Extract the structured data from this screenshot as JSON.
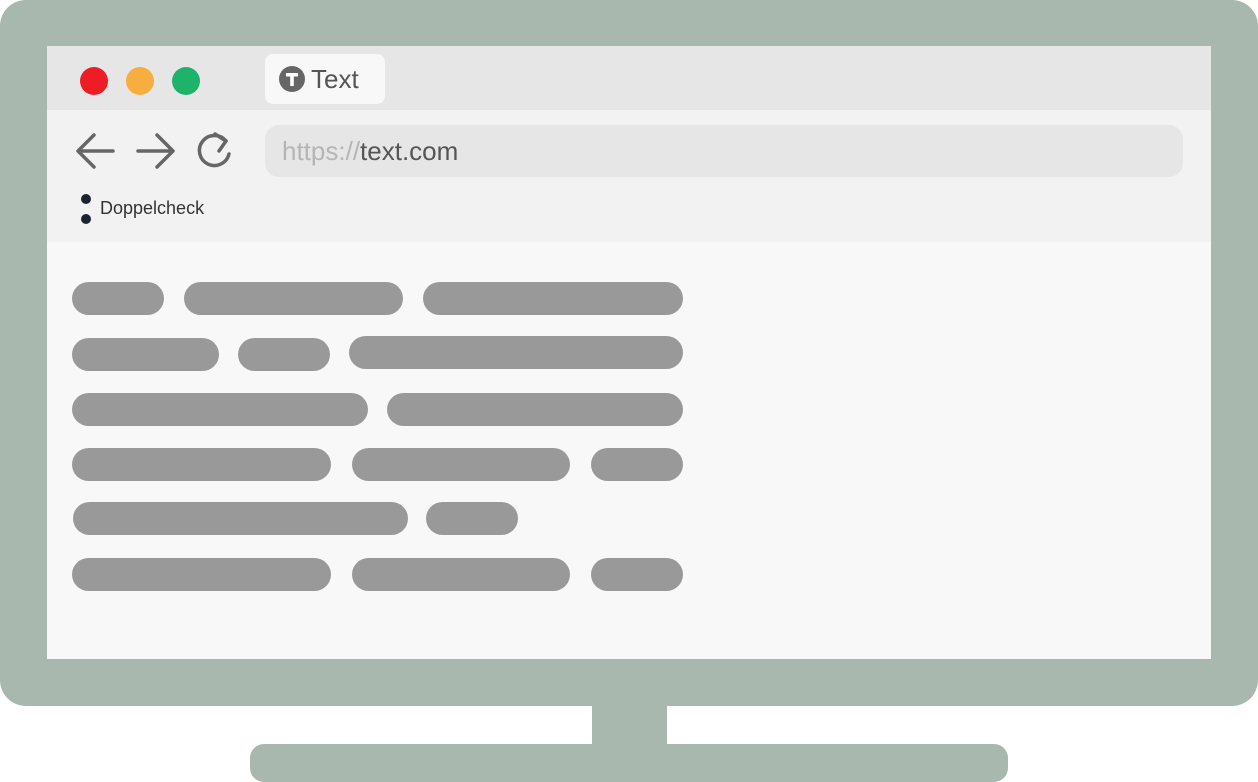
{
  "window_controls": {
    "close_color": "#ee1c25",
    "minimize_color": "#f8ae3e",
    "maximize_color": "#1eb26b"
  },
  "tab": {
    "icon": "t-letter-circle-icon",
    "label": "Text"
  },
  "nav": {
    "back_icon": "arrow-left-icon",
    "forward_icon": "arrow-right-icon",
    "reload_icon": "reload-icon"
  },
  "address_bar": {
    "protocol": "https://",
    "host": "text.com"
  },
  "bookmarks": [
    {
      "icon": "colon-dots-icon",
      "label": "Doppelcheck"
    }
  ],
  "colors": {
    "frame": "#a9b8ae",
    "placeholder_bar": "#999999"
  }
}
